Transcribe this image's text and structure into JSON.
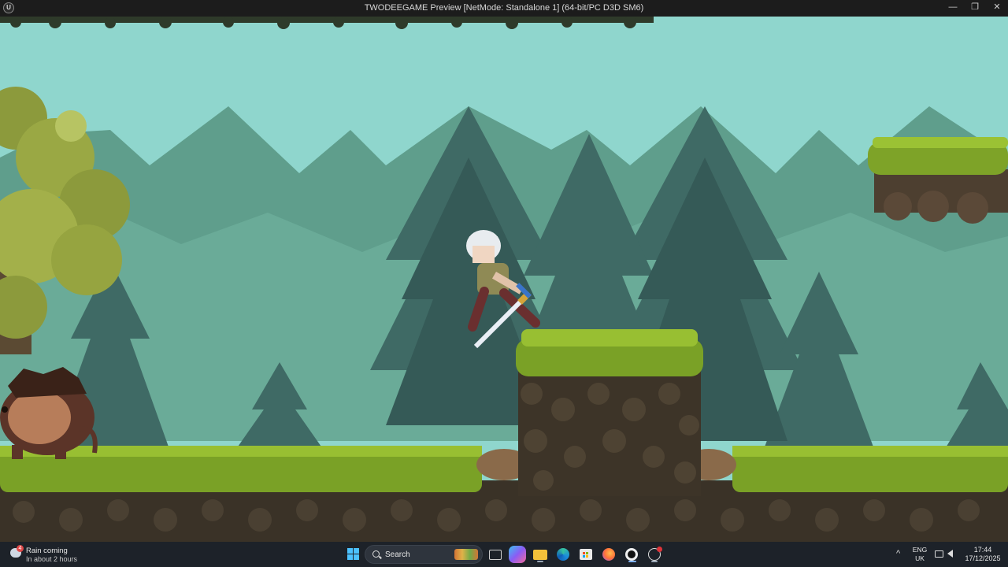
{
  "window": {
    "title": "TWODEEGAME Preview [NetMode: Standalone 1]  (64-bit/PC D3D SM6)",
    "logo_text": "U",
    "minimize_icon": "minimize-icon",
    "maximize_icon": "restore-icon",
    "close_icon": "close-icon",
    "minimize_glyph": "—",
    "restore_glyph": "❐",
    "close_glyph": "✕"
  },
  "game": {
    "scene": "forest-platformer",
    "sky_color": "#8fd6cd",
    "player": "white-haired swordswoman jumping",
    "enemy": "boar creature",
    "platforms": [
      "grass-rock-pillar",
      "floating-grass-island",
      "ground"
    ]
  },
  "taskbar": {
    "weather_title": "Rain coming",
    "weather_subtitle": "In about 2 hours",
    "weather_badge": "4",
    "search_label": "Search",
    "apps": [
      {
        "name": "task-view-icon"
      },
      {
        "name": "copilot-icon"
      },
      {
        "name": "file-explorer-icon"
      },
      {
        "name": "edge-icon"
      },
      {
        "name": "store-icon"
      },
      {
        "name": "firefox-icon"
      },
      {
        "name": "unreal-engine-icon"
      },
      {
        "name": "github-desktop-icon"
      }
    ],
    "lang_line1": "ENG",
    "lang_line2": "UK",
    "time": "17:44",
    "date": "17/12/2025",
    "chevron": "^"
  }
}
